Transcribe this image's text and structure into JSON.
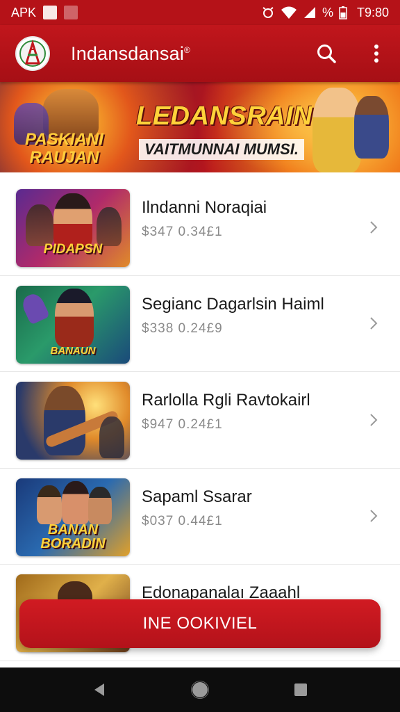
{
  "status_bar": {
    "left_text": "APK",
    "time": "T9:80",
    "battery_text": "%"
  },
  "app_bar": {
    "title": "Indansdansai",
    "title_mark": "®"
  },
  "banner": {
    "title": "LEDANSRAIN",
    "subtitle": "VAITMUNNAI MUMSI.",
    "left_logo_line1": "PASKIANI",
    "left_logo_line2": "RAUJAN"
  },
  "items": [
    {
      "title": "Ilndanni Noraqiai",
      "meta": "$347  0.34£1",
      "thumb_label": "PIDAPSN"
    },
    {
      "title": "Segianc Dagarlsin Haiml",
      "meta": "$338  0.24£9",
      "thumb_label": "BANAUN"
    },
    {
      "title": "Rarlolla Rgli Ravtokairl",
      "meta": "$947  0.24£1",
      "thumb_label": ""
    },
    {
      "title": "Sapaml Ssarar",
      "meta": "$037  0.44£1",
      "thumb_label": "BANAN BORADIN"
    },
    {
      "title": "Edonapanalaı Zaaahl",
      "meta": "",
      "thumb_label": ""
    }
  ],
  "cta": {
    "label": "INE OOKIVIEL"
  },
  "colors": {
    "brand_red": "#b51218",
    "cta_red": "#c8161e",
    "nav_bar": "#0d0d0d"
  },
  "icons": {
    "search": "search-icon",
    "menu": "more-vertical-icon",
    "chevron": "chevron-right-icon",
    "back": "back-triangle-icon",
    "home": "home-circle-icon",
    "recents": "recents-square-icon"
  }
}
